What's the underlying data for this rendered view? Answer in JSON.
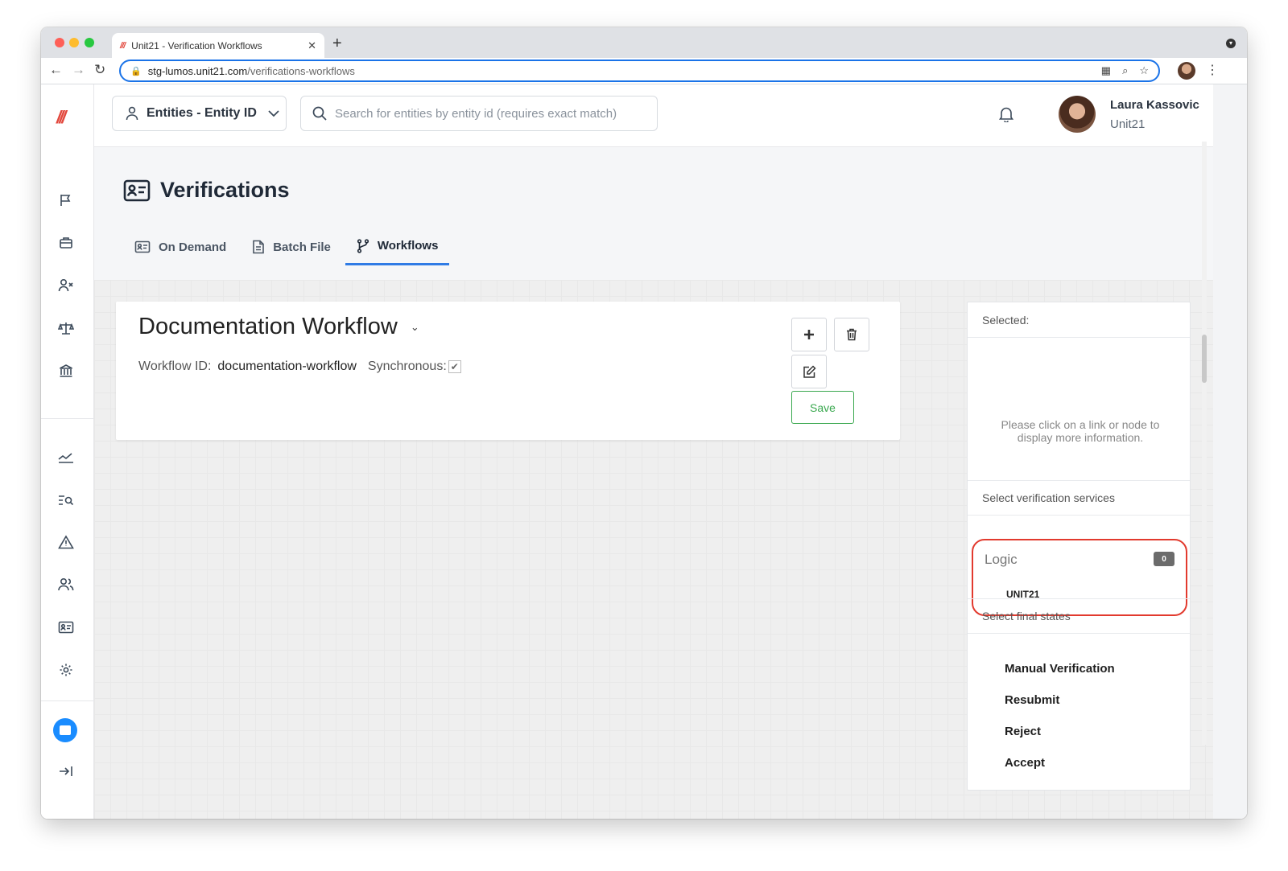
{
  "browser": {
    "tab_title": "Unit21 - Verification Workflows",
    "tab_favicon": "///",
    "url_host": "stg-lumos.unit21.com",
    "url_path": "/verifications-workflows"
  },
  "sidebar": {
    "logo": "///",
    "items": [
      {
        "icon": "flag-icon"
      },
      {
        "icon": "briefcase-icon"
      },
      {
        "icon": "user-x-icon"
      },
      {
        "icon": "scale-icon"
      },
      {
        "icon": "bank-icon"
      },
      {
        "icon": "chart-icon"
      },
      {
        "icon": "search-list-icon"
      },
      {
        "icon": "alert-triangle-icon"
      },
      {
        "icon": "users-icon"
      },
      {
        "icon": "id-card-icon"
      },
      {
        "icon": "gear-icon"
      }
    ]
  },
  "header": {
    "entity_select": "Entities - Entity ID",
    "search_placeholder": "Search for entities by entity id (requires exact match)",
    "user_name": "Laura Kassovic",
    "user_org": "Unit21"
  },
  "page": {
    "title": "Verifications",
    "tabs": [
      {
        "label": "On Demand",
        "active": false
      },
      {
        "label": "Batch File",
        "active": false
      },
      {
        "label": "Workflows",
        "active": true
      }
    ]
  },
  "workflow": {
    "name": "Documentation Workflow",
    "id_label": "Workflow ID:",
    "id_value": "documentation-workflow",
    "sync_label": "Synchronous:",
    "synchronous": true,
    "save_label": "Save"
  },
  "panel": {
    "selected_label": "Selected:",
    "info_text": "Please click on a link or node to display more information.",
    "services_label": "Select verification services",
    "logic_label": "Logic",
    "logic_count": "0",
    "logic_item": "UNIT21",
    "final_states_label": "Select final states",
    "final_states": [
      "Manual Verification",
      "Resubmit",
      "Reject",
      "Accept"
    ]
  },
  "colors": {
    "accent": "#2f7be5",
    "brand": "#e2483d",
    "save_green": "#3aa84f",
    "highlight_red": "#e23a2e"
  }
}
